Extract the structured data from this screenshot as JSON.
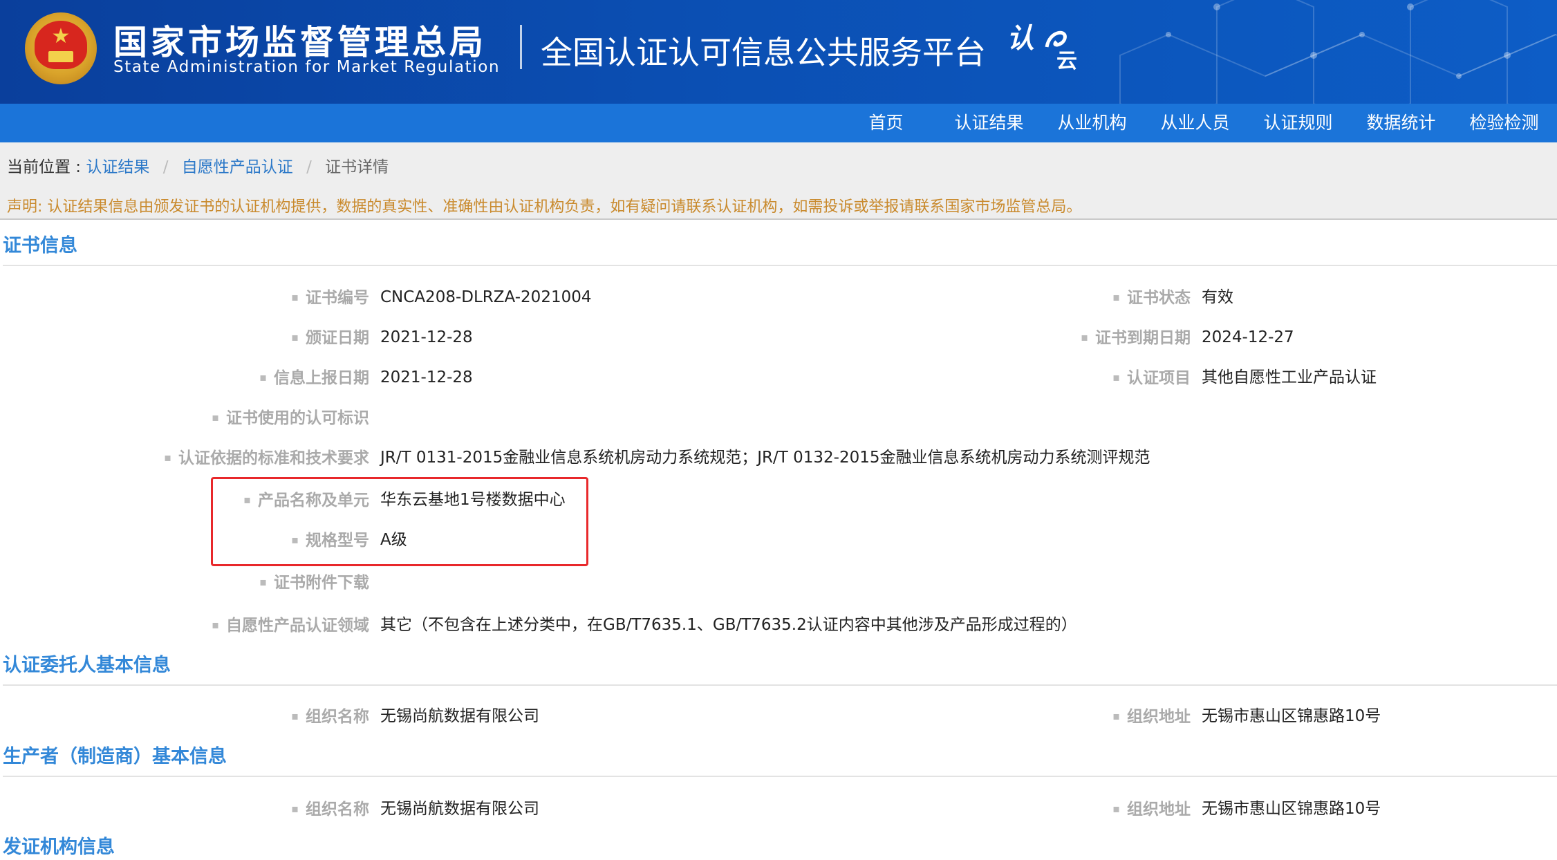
{
  "header": {
    "agency_name_cn": "国家市场监督管理总局",
    "agency_name_en": "State Administration  for  Market Regulation",
    "platform_name": "全国认证认可信息公共服务平台",
    "platform_logo": "认",
    "platform_logo_sub": "云",
    "emblem_icon": "national-emblem-icon",
    "banner_color": "#0b4fb3"
  },
  "nav": {
    "items": [
      "首页",
      "认证结果",
      "从业机构",
      "从业人员",
      "认证规则",
      "数据统计",
      "检验检测"
    ],
    "bar_color": "#1b74d9"
  },
  "breadcrumb": {
    "prefix": "当前位置 :",
    "items": [
      "认证结果",
      "自愿性产品认证",
      "证书详情"
    ],
    "separator": "/"
  },
  "notice": "声明: 认证结果信息由颁发证书的认证机构提供，数据的真实性、准确性由认证机构负责，如有疑问请联系认证机构，如需投诉或举报请联系国家市场监管总局。",
  "certificate": {
    "title": "证书信息",
    "cert_no_label": "证书编号",
    "cert_no": "CNCA208-DLRZA-2021004",
    "status_label": "证书状态",
    "status": "有效",
    "issue_date_label": "颁证日期",
    "issue_date": "2021-12-28",
    "expire_date_label": "证书到期日期",
    "expire_date": "2024-12-27",
    "report_date_label": "信息上报日期",
    "report_date": "2021-12-28",
    "item_label": "认证项目",
    "item": "其他自愿性工业产品认证",
    "mark_label": "证书使用的认可标识",
    "standards_label": "认证依据的标准和技术要求",
    "standards": "JR/T 0131-2015金融业信息系统机房动力系统规范；JR/T 0132-2015金融业信息系统机房动力系统测评规范",
    "product_label": "产品名称及单元",
    "product": "华东云基地1号楼数据中心",
    "spec_label": "规格型号",
    "spec": "A级",
    "attachment_label": "证书附件下载",
    "domain_label": "自愿性产品认证领域",
    "domain": "其它（不包含在上述分类中，在GB/T7635.1、GB/T7635.2认证内容中其他涉及产品形成过程的）"
  },
  "client": {
    "title": "认证委托人基本信息",
    "org_name_label": "组织名称",
    "org_name": "无锡尚航数据有限公司",
    "org_address_label": "组织地址",
    "org_address": "无锡市惠山区锦惠路10号"
  },
  "manufacturer": {
    "title": "生产者（制造商）基本信息",
    "org_name_label": "组织名称",
    "org_name": "无锡尚航数据有限公司",
    "org_address_label": "组织地址",
    "org_address": "无锡市惠山区锦惠路10号"
  },
  "issuer": {
    "title": "发证机构信息"
  },
  "colors": {
    "section_title": "#3388d8",
    "notice": "#c98a2d",
    "highlight": "#e8282b"
  }
}
